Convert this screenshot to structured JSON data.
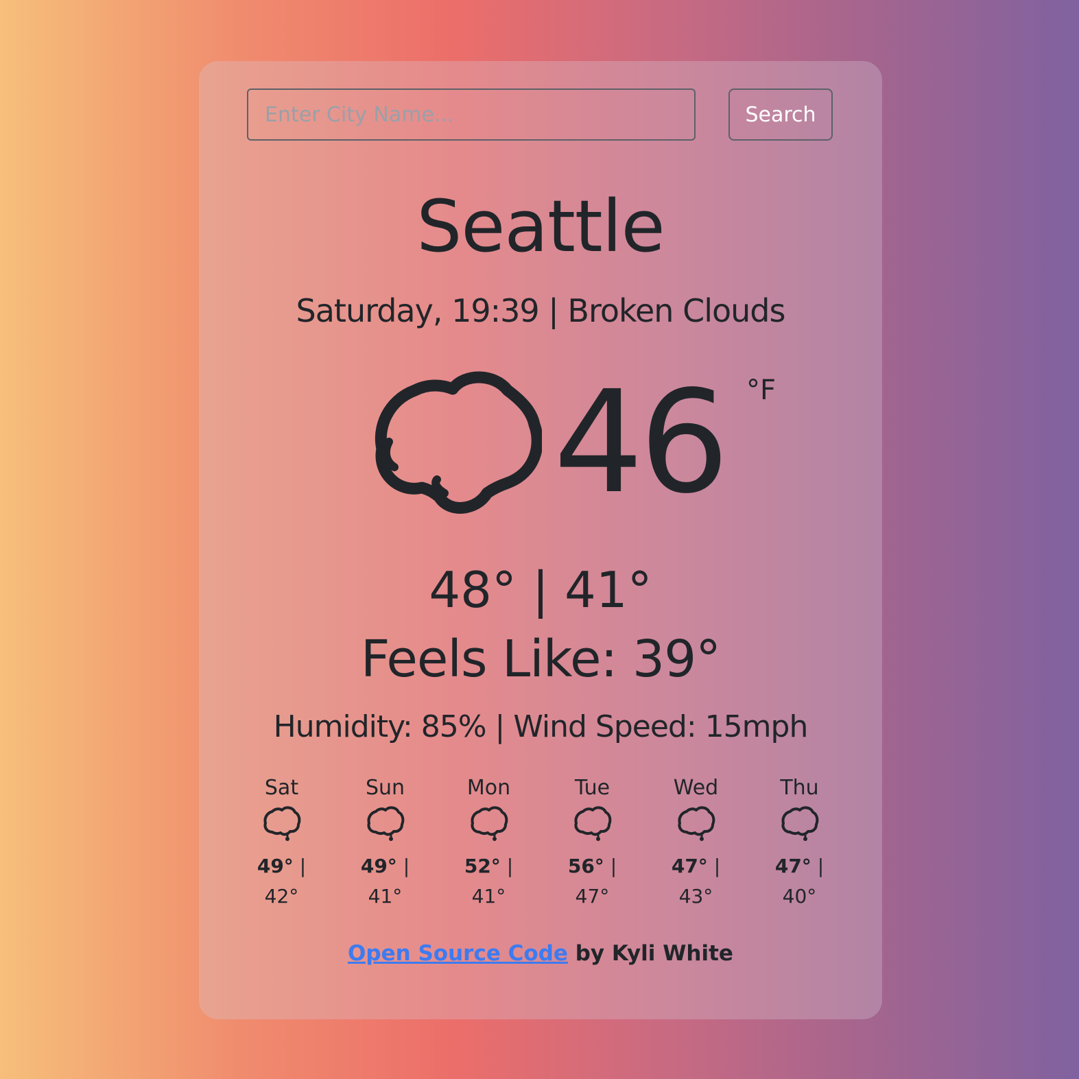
{
  "search": {
    "placeholder": "Enter City Name...",
    "button_label": "Search"
  },
  "current": {
    "city": "Seattle",
    "subtitle": "Saturday, 19:39 | Broken Clouds",
    "icon": "cloud-icon",
    "temperature": "46",
    "unit": "°F",
    "high_low": "48° | 41°",
    "feels_like": "Feels Like: 39°",
    "details": "Humidity: 85% | Wind Speed: 15mph"
  },
  "forecast": [
    {
      "day": "Sat",
      "high": "49°",
      "sep": " |",
      "low": "42°",
      "icon": "rain-cloud-icon"
    },
    {
      "day": "Sun",
      "high": "49°",
      "sep": " |",
      "low": "41°",
      "icon": "rain-cloud-icon"
    },
    {
      "day": "Mon",
      "high": "52°",
      "sep": " |",
      "low": "41°",
      "icon": "rain-cloud-icon"
    },
    {
      "day": "Tue",
      "high": "56°",
      "sep": " |",
      "low": "47°",
      "icon": "rain-cloud-icon"
    },
    {
      "day": "Wed",
      "high": "47°",
      "sep": " |",
      "low": "43°",
      "icon": "rain-cloud-icon"
    },
    {
      "day": "Thu",
      "high": "47°",
      "sep": " |",
      "low": "40°",
      "icon": "rain-cloud-icon"
    }
  ],
  "footer": {
    "link_text": "Open Source Code",
    "by_text": " by Kyli White",
    "link_color": "#3d7bf0"
  }
}
